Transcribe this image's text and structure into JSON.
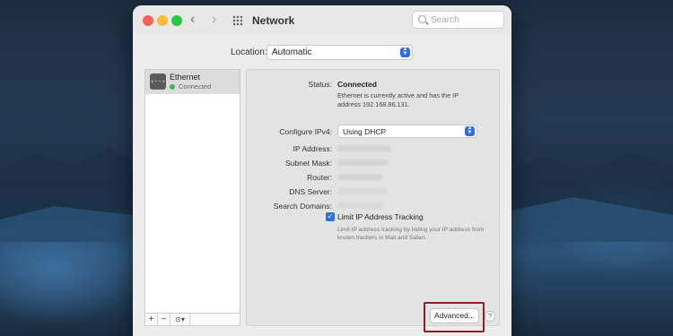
{
  "window": {
    "title": "Network",
    "search_placeholder": "Search"
  },
  "toolbar": {
    "back": "‹",
    "forward": "›"
  },
  "location": {
    "label": "Location:",
    "value": "Automatic"
  },
  "services": [
    {
      "name": "Ethernet",
      "status": "Connected",
      "icon": "ethernet-icon"
    }
  ],
  "sidebar_buttons": {
    "add": "+",
    "remove": "−",
    "action": "⊙▾"
  },
  "details": {
    "status_label": "Status:",
    "status_value": "Connected",
    "status_description": "Ethernet is currently active and has the IP address 192.168.86.131.",
    "configure_label": "Configure IPv4:",
    "configure_value": "Using DHCP",
    "ip_label": "IP Address:",
    "subnet_label": "Subnet Mask:",
    "router_label": "Router:",
    "dns_label": "DNS Server:",
    "search_domains_label": "Search Domains:",
    "limit_tracking_label": "Limit IP Address Tracking",
    "limit_tracking_checked": true,
    "limit_tracking_hint": "Limit IP address tracking by hiding your IP address from known trackers in Mail and Safari."
  },
  "buttons": {
    "advanced": "Advanced...",
    "help": "?"
  },
  "colors": {
    "accent": "#2f6ee3",
    "highlight_frame": "#8c1f1f",
    "connected": "#3fb64a"
  }
}
